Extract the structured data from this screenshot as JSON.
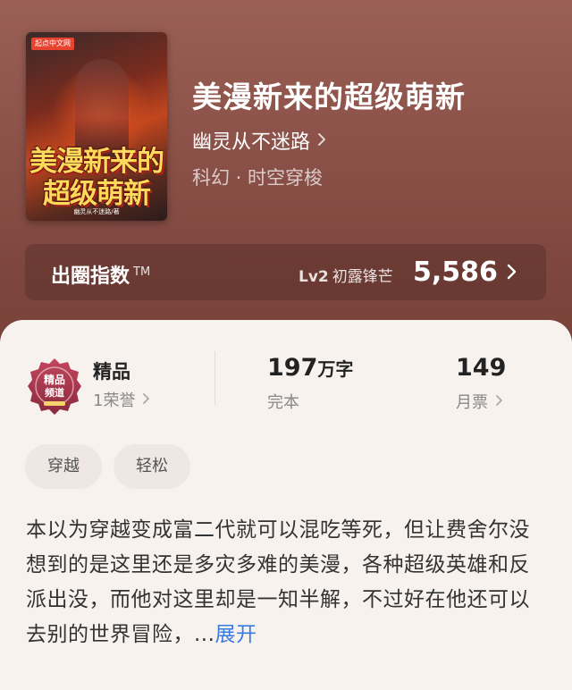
{
  "book": {
    "title": "美漫新来的超级萌新",
    "author": "幽灵从不迷路",
    "genre": "科幻 · 时空穿梭",
    "cover": {
      "badge": "起点中文网",
      "title_line1": "美漫新来的",
      "title_line2": "超级萌新",
      "author_text": "幽灵从不迷路/著"
    }
  },
  "index": {
    "label": "出圈指数",
    "tm": "TM",
    "level": "Lv2",
    "level_name": "初露锋芒",
    "value": "5,586"
  },
  "stats": {
    "medal_label": "精品",
    "medal_sub": "1荣誉",
    "words_value": "197",
    "words_unit": "万字",
    "words_sub": "完本",
    "votes_value": "149",
    "votes_sub": "月票"
  },
  "tags": [
    "穿越",
    "轻松"
  ],
  "synopsis": {
    "text": "本以为穿越变成富二代就可以混吃等死，但让费舍尔没想到的是这里还是多灾多难的美漫，各种超级英雄和反派出没，而他对这里却是一知半解，不过好在他还可以去别的世界冒险，...",
    "expand": "展开"
  },
  "colors": {
    "hero_bg": "#8c5249",
    "accent_link": "#3a7be0",
    "medal": "#a8344a"
  },
  "icons": {
    "author_chevron": "chevron-right-icon",
    "index_chevron": "chevron-right-icon",
    "medal": "premium-medal-icon"
  }
}
